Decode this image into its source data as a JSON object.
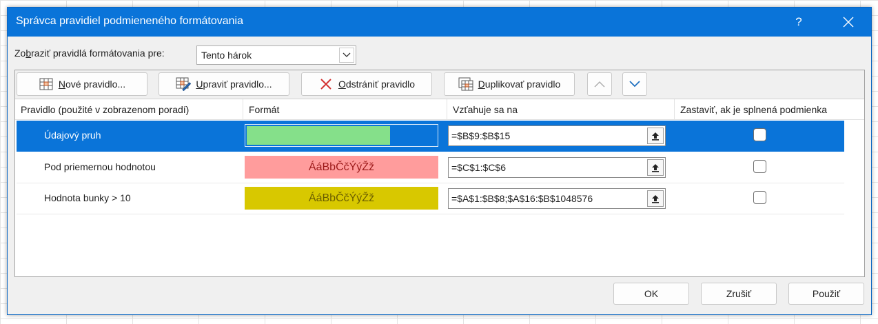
{
  "dialog": {
    "title": "Správca pravidiel podmieneného formátovania",
    "help_label": "?",
    "show_rules_label_prefix": "Zo",
    "show_rules_label_mnemonic": "b",
    "show_rules_label_suffix": "raziť pravidlá formátovania pre:",
    "scope_value": "Tento hárok"
  },
  "toolbar": {
    "new_rule_mnemonic": "N",
    "new_rule_rest": "ové pravidlo...",
    "edit_rule_mnemonic": "U",
    "edit_rule_rest": "praviť pravidlo...",
    "delete_rule_mnemonic": "O",
    "delete_rule_rest": "dstrániť pravidlo",
    "duplicate_rule_mnemonic": "D",
    "duplicate_rule_rest": "uplikovať pravidlo"
  },
  "table": {
    "columns": [
      "Pravidlo (použité v zobrazenom poradí)",
      "Formát",
      "Vzťahuje sa na",
      "Zastaviť, ak je splnená podmienka"
    ],
    "rows": [
      {
        "name": "Údajový pruh",
        "format_preview": "",
        "applies_to": "=$B$9:$B$15",
        "stop_if_true": false,
        "selected": true,
        "bar_fill_fraction": 0.75
      },
      {
        "name": "Pod priemernou hodnotou",
        "format_preview": "ÁáBbČčÝýŽž",
        "applies_to": "=$C$1:$C$6",
        "stop_if_true": false,
        "selected": false
      },
      {
        "name": "Hodnota bunky > 10",
        "format_preview": "ÁáBbČčÝýŽž",
        "applies_to": "=$A$1:$B$8;$A$16:$B$1048576",
        "stop_if_true": false,
        "selected": false
      }
    ]
  },
  "buttons": {
    "ok": "OK",
    "cancel": "Zrušiť",
    "apply": "Použiť"
  },
  "colors": {
    "title_bar": "#0a74d9",
    "selection": "#0a74d9",
    "data_bar": "#85e08a",
    "below_avg_fill": "#ff9c9c",
    "below_avg_text": "#9c1a1a",
    "value_fill": "#d8c800",
    "value_text": "#6b5e00"
  }
}
